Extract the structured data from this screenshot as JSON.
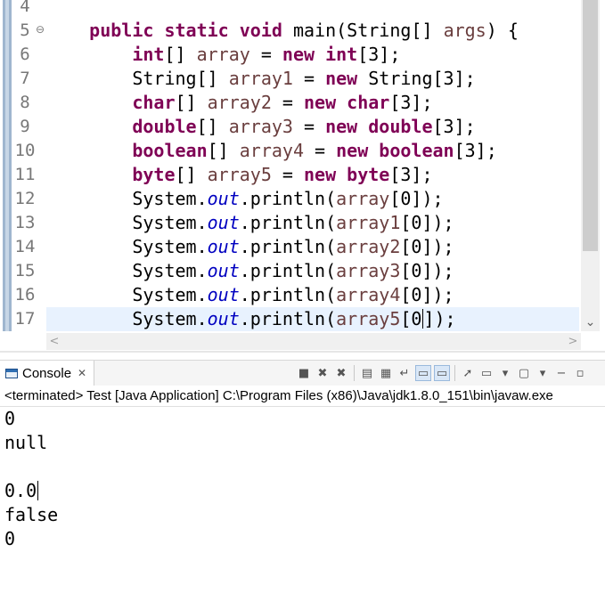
{
  "editor": {
    "line_numbers": [
      "4",
      "5",
      "6",
      "7",
      "8",
      "9",
      "10",
      "11",
      "12",
      "13",
      "14",
      "15",
      "16",
      "17"
    ],
    "fold_marker": "⊖",
    "lines": [
      [],
      [
        {
          "t": "    "
        },
        {
          "t": "public",
          "c": "kw"
        },
        {
          "t": " "
        },
        {
          "t": "static",
          "c": "kw"
        },
        {
          "t": " "
        },
        {
          "t": "void",
          "c": "kw"
        },
        {
          "t": " main(String[] "
        },
        {
          "t": "args",
          "c": "var"
        },
        {
          "t": ") {"
        }
      ],
      [
        {
          "t": "        "
        },
        {
          "t": "int",
          "c": "kw"
        },
        {
          "t": "[] "
        },
        {
          "t": "array",
          "c": "var"
        },
        {
          "t": " = "
        },
        {
          "t": "new",
          "c": "kw"
        },
        {
          "t": " "
        },
        {
          "t": "int",
          "c": "kw"
        },
        {
          "t": "[3];"
        }
      ],
      [
        {
          "t": "        String[] "
        },
        {
          "t": "array1",
          "c": "var"
        },
        {
          "t": " = "
        },
        {
          "t": "new",
          "c": "kw"
        },
        {
          "t": " String[3];"
        }
      ],
      [
        {
          "t": "        "
        },
        {
          "t": "char",
          "c": "kw"
        },
        {
          "t": "[] "
        },
        {
          "t": "array2",
          "c": "var"
        },
        {
          "t": " = "
        },
        {
          "t": "new",
          "c": "kw"
        },
        {
          "t": " "
        },
        {
          "t": "char",
          "c": "kw"
        },
        {
          "t": "[3];"
        }
      ],
      [
        {
          "t": "        "
        },
        {
          "t": "double",
          "c": "kw"
        },
        {
          "t": "[] "
        },
        {
          "t": "array3",
          "c": "var"
        },
        {
          "t": " = "
        },
        {
          "t": "new",
          "c": "kw"
        },
        {
          "t": " "
        },
        {
          "t": "double",
          "c": "kw"
        },
        {
          "t": "[3];"
        }
      ],
      [
        {
          "t": "        "
        },
        {
          "t": "boolean",
          "c": "kw"
        },
        {
          "t": "[] "
        },
        {
          "t": "array4",
          "c": "var"
        },
        {
          "t": " = "
        },
        {
          "t": "new",
          "c": "kw"
        },
        {
          "t": " "
        },
        {
          "t": "boolean",
          "c": "kw"
        },
        {
          "t": "[3];"
        }
      ],
      [
        {
          "t": "        "
        },
        {
          "t": "byte",
          "c": "kw"
        },
        {
          "t": "[] "
        },
        {
          "t": "array5",
          "c": "var"
        },
        {
          "t": " = "
        },
        {
          "t": "new",
          "c": "kw"
        },
        {
          "t": " "
        },
        {
          "t": "byte",
          "c": "kw"
        },
        {
          "t": "[3];"
        }
      ],
      [
        {
          "t": "        System."
        },
        {
          "t": "out",
          "c": "fld"
        },
        {
          "t": ".println("
        },
        {
          "t": "array",
          "c": "var"
        },
        {
          "t": "[0]);"
        }
      ],
      [
        {
          "t": "        System."
        },
        {
          "t": "out",
          "c": "fld"
        },
        {
          "t": ".println("
        },
        {
          "t": "array1",
          "c": "var"
        },
        {
          "t": "[0]);"
        }
      ],
      [
        {
          "t": "        System."
        },
        {
          "t": "out",
          "c": "fld"
        },
        {
          "t": ".println("
        },
        {
          "t": "array2",
          "c": "var"
        },
        {
          "t": "[0]);"
        }
      ],
      [
        {
          "t": "        System."
        },
        {
          "t": "out",
          "c": "fld"
        },
        {
          "t": ".println("
        },
        {
          "t": "array3",
          "c": "var"
        },
        {
          "t": "[0]);"
        }
      ],
      [
        {
          "t": "        System."
        },
        {
          "t": "out",
          "c": "fld"
        },
        {
          "t": ".println("
        },
        {
          "t": "array4",
          "c": "var"
        },
        {
          "t": "[0]);"
        }
      ],
      [
        {
          "t": "        System."
        },
        {
          "t": "out",
          "c": "fld"
        },
        {
          "t": ".println("
        },
        {
          "t": "array5",
          "c": "var"
        },
        {
          "t": "[0"
        },
        {
          "t": "",
          "c": "caret"
        },
        {
          "t": "]);"
        }
      ]
    ],
    "current_line_index": 13,
    "scroll_down_arrow": "⌄",
    "scroll_left_arrow": "<",
    "scroll_right_arrow": ">"
  },
  "console": {
    "tab_label": "Console",
    "tab_close": "✕",
    "status": "<terminated> Test [Java Application] C:\\Program Files (x86)\\Java\\jdk1.8.0_151\\bin\\javaw.exe",
    "toolbar_icons": [
      {
        "name": "terminate-icon",
        "glyph": "■"
      },
      {
        "name": "remove-launch-icon",
        "glyph": "✖"
      },
      {
        "name": "remove-all-terminated-icon",
        "glyph": "✖"
      },
      {
        "sep": true
      },
      {
        "name": "clear-console-icon",
        "glyph": "▤"
      },
      {
        "name": "scroll-lock-icon",
        "glyph": "▦"
      },
      {
        "name": "word-wrap-icon",
        "glyph": "↵"
      },
      {
        "name": "show-on-stdout-icon",
        "glyph": "▭",
        "active": true
      },
      {
        "name": "show-on-stderr-icon",
        "glyph": "▭",
        "active": true
      },
      {
        "sep": true
      },
      {
        "name": "pin-console-icon",
        "glyph": "➚"
      },
      {
        "name": "display-selected-console-icon",
        "glyph": "▭"
      },
      {
        "name": "display-selected-console-dropdown-icon",
        "glyph": "▾"
      },
      {
        "name": "open-console-icon",
        "glyph": "▢"
      },
      {
        "name": "open-console-dropdown-icon",
        "glyph": "▾"
      },
      {
        "name": "minimize-icon",
        "glyph": "−"
      },
      {
        "name": "maximize-icon",
        "glyph": "▫"
      }
    ],
    "output": [
      "0",
      "null",
      "",
      "0.0",
      "false",
      "0"
    ],
    "output_caret_line": 3
  },
  "colors": {
    "keyword": "#7f0055",
    "variable": "#6a3e3e",
    "static_field": "#0000c0",
    "current_line": "#e8f2fe",
    "gutter_marker": "#9fb6cf"
  }
}
